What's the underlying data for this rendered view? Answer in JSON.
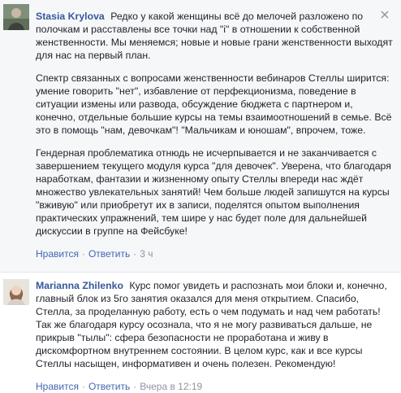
{
  "comments": [
    {
      "author": "Stasia Krylova",
      "paragraphs": [
        "Редко у какой женщины всё до мелочей разложено по полочкам и расставлены все точки над \"i\" в отношении к собственной женственности. Мы меняемся; новые и новые грани женственности выходят для нас на первый план.",
        "Спектр связанных с вопросами женственности вебинаров Стеллы ширится: умение говорить \"нет\", избавление от перфекционизма, поведение в ситуации измены или развода, обсуждение бюджета с партнером и, конечно, отдельные большие курсы на темы взаимоотношений в семье. Всё это в помощь \"нам, девочкам\"! \"Мальчикам и юношам\", впрочем, тоже.",
        "Гендерная проблематика отнюдь не исчерпывается и не заканчивается с завершением текущего модуля курса \"для девочек\". Уверена, что благодаря наработкам, фантазии и жизненному опыту Стеллы впереди нас ждёт множество увлекательных занятий! Чем больше людей запишутся на курсы \"вживую\" или приобретут их в записи, поделятся опытом выполнения практических упражнений, тем шире у нас будет поле для дальнейшей дискуссии в группе на Фейсбуке!"
      ],
      "actions": {
        "like": "Нравится",
        "reply": "Ответить",
        "time": "3 ч"
      }
    },
    {
      "author": "Marianna Zhilenko",
      "paragraphs": [
        "Курс помог увидеть и распознать мои блоки и, конечно, главный блок из 5го занятия оказался для меня открытием. Спасибо, Стелла, за проделанную работу, есть о чем подумать и над чем работать! Так же благодаря курсу осознала, что я не могу развиваться дальше, не прикрыв \"тылы\": сфера безопасности не проработана и живу в дискомфортном внутреннем состоянии. В целом курс, как и все курсы Стеллы насыщен, информативен и очень полезен. Рекомендую!"
      ],
      "actions": {
        "like": "Нравится",
        "reply": "Ответить",
        "time": "Вчера в 12:19"
      }
    }
  ],
  "icons": {
    "close": "close-icon",
    "avatar": "avatar"
  },
  "colors": {
    "author": "#365899",
    "link": "#4267b2",
    "meta": "#90949c",
    "highlight_bg": "#f6f7f9"
  }
}
